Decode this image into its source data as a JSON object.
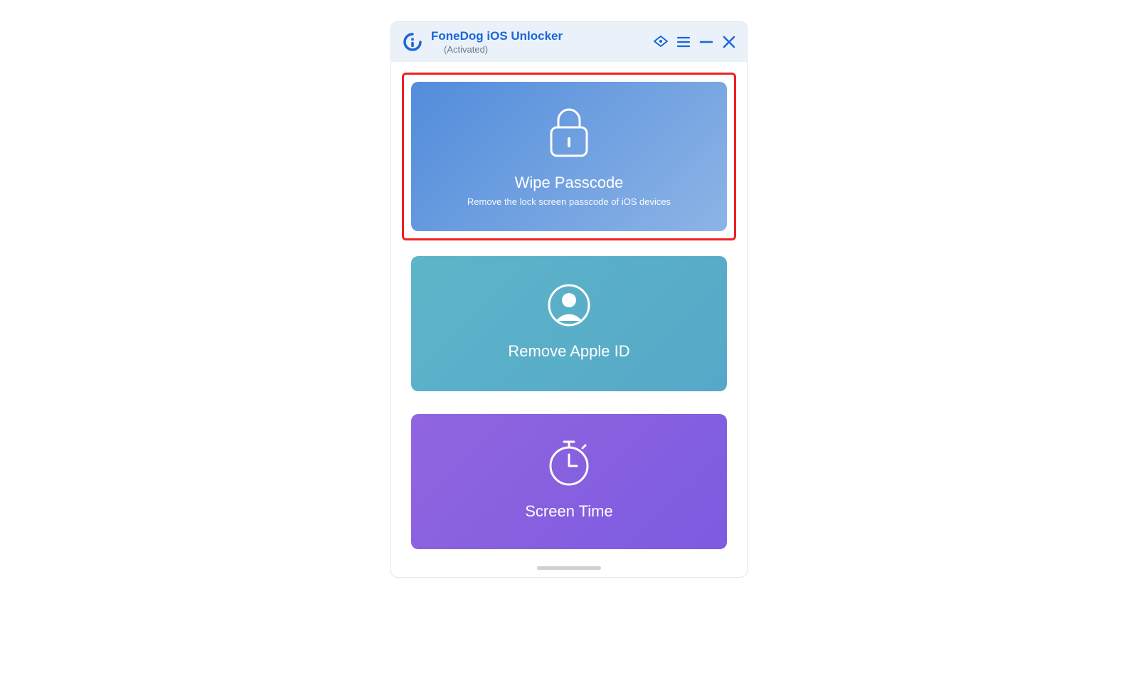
{
  "header": {
    "title": "FoneDog iOS Unlocker",
    "subtitle": "(Activated)"
  },
  "cards": {
    "wipe": {
      "title": "Wipe Passcode",
      "subtitle": "Remove the lock screen passcode of iOS devices"
    },
    "apple": {
      "title": "Remove Apple ID"
    },
    "screentime": {
      "title": "Screen Time"
    }
  }
}
